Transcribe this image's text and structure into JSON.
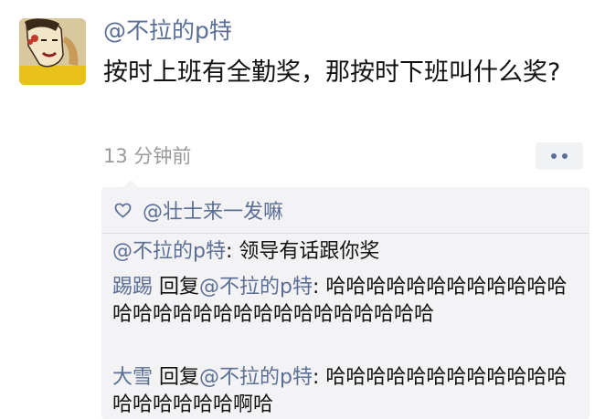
{
  "post": {
    "author": "@不拉的p特",
    "text": "按时上班有全勤奖，那按时下班叫什么奖?",
    "time": "13 分钟前"
  },
  "likes": {
    "users": "@壮士来一发嘛"
  },
  "comments": [
    {
      "author": "@不拉的p特",
      "separator": ":",
      "text": " 领导有话跟你奖"
    },
    {
      "author": "踢踢",
      "reply_word": " 回复",
      "reply_to": "@不拉的p特",
      "separator": ":",
      "text": " 哈哈哈哈哈哈哈哈哈哈哈哈哈哈哈哈哈哈哈哈哈哈哈哈哈哈哈哈"
    },
    {
      "author": "大雪",
      "reply_word": " 回复",
      "reply_to": "@不拉的p特",
      "separator": ":",
      "text": " 哈哈哈哈哈哈哈哈哈哈哈哈哈哈哈哈哈哈啊哈"
    }
  ],
  "colors": {
    "name_link": "#5a6e96",
    "time_gray": "#9a9a9a",
    "comment_bg": "#f3f3f5"
  },
  "icons": {
    "more": "more-dots-icon",
    "like": "heart-icon"
  }
}
